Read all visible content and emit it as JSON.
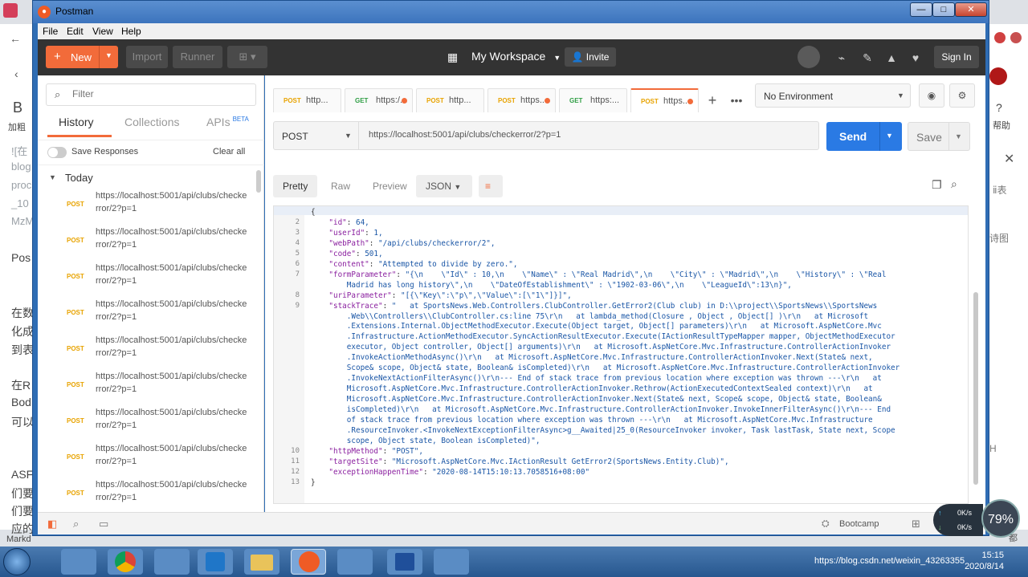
{
  "window": {
    "title": "Postman",
    "minimize": "—",
    "maximize": "□",
    "close": "✕"
  },
  "menu": [
    "File",
    "Edit",
    "View",
    "Help"
  ],
  "header": {
    "new_label": "New",
    "import_label": "Import",
    "runner_label": "Runner",
    "workspace_label": "My Workspace",
    "invite_label": "Invite",
    "signin_label": "Sign In"
  },
  "sidebar": {
    "filter_placeholder": "Filter",
    "tabs": {
      "history": "History",
      "collections": "Collections",
      "apis": "APIs",
      "beta": "BETA"
    },
    "save_responses": "Save Responses",
    "clear_all": "Clear all",
    "group": "Today",
    "items": [
      {
        "method": "POST",
        "url": "https://localhost:5001/api/clubs/checkerror/2?p=1"
      },
      {
        "method": "POST",
        "url": "https://localhost:5001/api/clubs/checkerror/2?p=1"
      },
      {
        "method": "POST",
        "url": "https://localhost:5001/api/clubs/checkerror/2?p=1"
      },
      {
        "method": "POST",
        "url": "https://localhost:5001/api/clubs/checkerror/2?p=1"
      },
      {
        "method": "POST",
        "url": "https://localhost:5001/api/clubs/checkerror/2?p=1"
      },
      {
        "method": "POST",
        "url": "https://localhost:5001/api/clubs/checkerror/2?p=1"
      },
      {
        "method": "POST",
        "url": "https://localhost:5001/api/clubs/checkerror/2?p=1"
      },
      {
        "method": "POST",
        "url": "https://localhost:5001/api/clubs/checkerror/2?p=1"
      },
      {
        "method": "POST",
        "url": "https://localhost:5001/api/clubs/checkerror/2?p=1"
      }
    ]
  },
  "request_tabs": [
    {
      "method": "POST",
      "label": "http...",
      "dot": false
    },
    {
      "method": "GET",
      "label": "https:/...",
      "dot": true
    },
    {
      "method": "POST",
      "label": "http...",
      "dot": false
    },
    {
      "method": "POST",
      "label": "https...",
      "dot": true
    },
    {
      "method": "GET",
      "label": "https:...",
      "dot": false
    },
    {
      "method": "POST",
      "label": "https...",
      "dot": true
    }
  ],
  "environment": {
    "selected": "No Environment"
  },
  "request": {
    "method": "POST",
    "url": "https://localhost:5001/api/clubs/checkerror/2?p=1",
    "send_label": "Send",
    "save_label": "Save"
  },
  "response": {
    "views": [
      "Pretty",
      "Raw",
      "Preview"
    ],
    "format": "JSON",
    "lines": [
      "{",
      "    \"id\": 64,",
      "    \"userId\": 1,",
      "    \"webPath\": \"/api/clubs/checkerror/2\",",
      "    \"code\": 501,",
      "    \"content\": \"Attempted to divide by zero.\",",
      "    \"formParameter\": \"{\\n    \\\"Id\\\" : 10,\\n    \\\"Name\\\" : \\\"Real Madrid\\\",\\n    \\\"City\\\" : \\\"Madrid\\\",\\n    \\\"History\\\" : \\\"Real",
      "        Madrid has long history\\\",\\n    \\\"DateOfEstablishment\\\" : \\\"1902-03-06\\\",\\n    \\\"LeagueId\\\":13\\n}\",",
      "    \"uriParameter\": \"[{\\\"Key\\\":\\\"p\\\",\\\"Value\\\":[\\\"1\\\"]}]\",",
      "    \"stackTrace\": \"   at SportsNews.Web.Controllers.ClubController.GetError2(Club club) in D:\\\\project\\\\SportsNews\\\\SportsNews",
      "        .Web\\\\Controllers\\\\ClubController.cs:line 75\\r\\n   at lambda_method(Closure , Object , Object[] )\\r\\n   at Microsoft",
      "        .Extensions.Internal.ObjectMethodExecutor.Execute(Object target, Object[] parameters)\\r\\n   at Microsoft.AspNetCore.Mvc",
      "        .Infrastructure.ActionMethodExecutor.SyncActionResultExecutor.Execute(IActionResultTypeMapper mapper, ObjectMethodExecutor",
      "        executor, Object controller, Object[] arguments)\\r\\n   at Microsoft.AspNetCore.Mvc.Infrastructure.ControllerActionInvoker",
      "        .InvokeActionMethodAsync()\\r\\n   at Microsoft.AspNetCore.Mvc.Infrastructure.ControllerActionInvoker.Next(State& next,",
      "        Scope& scope, Object& state, Boolean& isCompleted)\\r\\n   at Microsoft.AspNetCore.Mvc.Infrastructure.ControllerActionInvoker",
      "        .InvokeNextActionFilterAsync()\\r\\n--- End of stack trace from previous location where exception was thrown ---\\r\\n   at",
      "        Microsoft.AspNetCore.Mvc.Infrastructure.ControllerActionInvoker.Rethrow(ActionExecutedContextSealed context)\\r\\n   at",
      "        Microsoft.AspNetCore.Mvc.Infrastructure.ControllerActionInvoker.Next(State& next, Scope& scope, Object& state, Boolean&",
      "        isCompleted)\\r\\n   at Microsoft.AspNetCore.Mvc.Infrastructure.ControllerActionInvoker.InvokeInnerFilterAsync()\\r\\n--- End",
      "        of stack trace from previous location where exception was thrown ---\\r\\n   at Microsoft.AspNetCore.Mvc.Infrastructure",
      "        .ResourceInvoker.<InvokeNextExceptionFilterAsync>g__Awaited|25_0(ResourceInvoker invoker, Task lastTask, State next, Scope",
      "        scope, Object state, Boolean isCompleted)\",",
      "    \"httpMethod\": \"POST\",",
      "    \"targetSite\": \"Microsoft.AspNetCore.Mvc.IActionResult GetError2(SportsNews.Entity.Club)\",",
      "    \"exceptionHappenTime\": \"2020-08-14T15:10:13.7058516+08:00\"",
      "}"
    ],
    "line_numbers": [
      "1",
      "2",
      "3",
      "4",
      "5",
      "6",
      "7",
      "",
      "8",
      "9",
      "",
      "",
      "",
      "",
      "",
      "",
      "",
      "",
      "",
      "",
      "",
      "",
      "",
      "10",
      "11",
      "12",
      "13"
    ]
  },
  "statusbar": {
    "bootcamp": "Bootcamp"
  },
  "background_page": {
    "left_texts": [
      "加粗",
      "![在",
      "blog",
      "proc",
      "_10",
      "MzM",
      "Pos",
      "在数",
      "化成",
      "到表",
      "在R",
      "Bod",
      "可以",
      "ASF",
      "们要",
      "们要",
      "应的",
      "Markd"
    ],
    "right_texts": [
      "帮助",
      "ⅱ表",
      "诗图",
      "H",
      "都"
    ],
    "letter_b": "B"
  },
  "tray": {
    "up_speed": "0K/s",
    "down_speed": "0K/s",
    "gauge": "79%",
    "time": "15:15",
    "date": "2020/8/14",
    "watermark": "https://blog.csdn.net/weixin_43263355"
  }
}
